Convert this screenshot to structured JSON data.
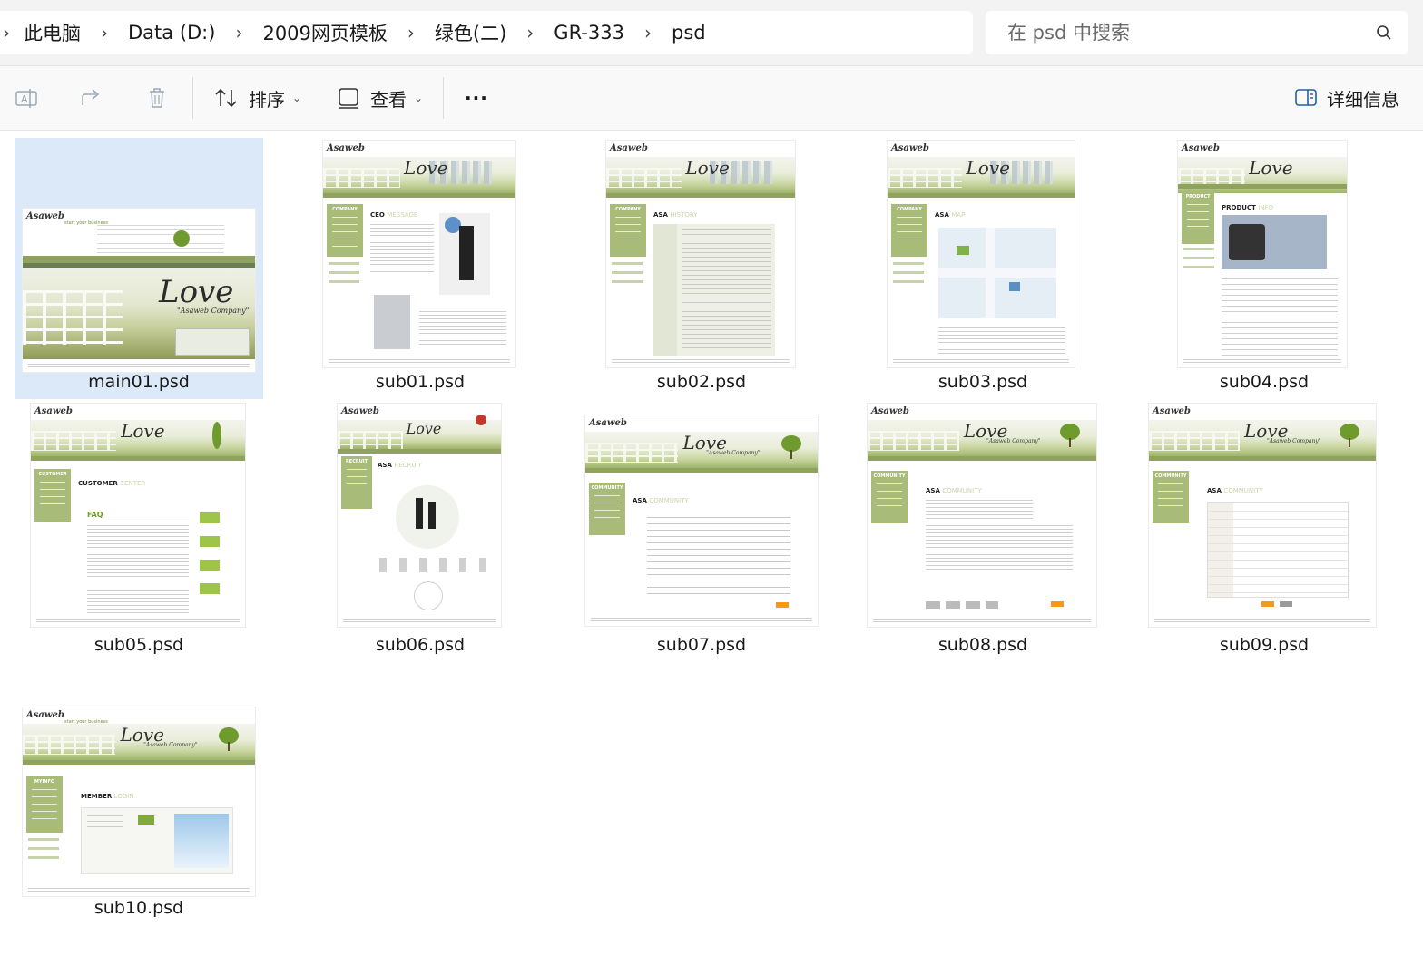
{
  "addressbar": {
    "crumbs": [
      "此电脑",
      "Data (D:)",
      "2009网页模板",
      "绿色(二)",
      "GR-333",
      "psd"
    ],
    "search_placeholder": "在 psd 中搜索"
  },
  "toolbar": {
    "rename_icon": "rename-icon",
    "share_icon": "share-icon",
    "delete_icon": "delete-icon",
    "sort_label": "排序",
    "view_label": "查看",
    "more_label": "···",
    "details_label": "详细信息"
  },
  "files": [
    {
      "name": "main01.psd",
      "selected": true
    },
    {
      "name": "sub01.psd"
    },
    {
      "name": "sub02.psd"
    },
    {
      "name": "sub03.psd"
    },
    {
      "name": "sub04.psd"
    },
    {
      "name": "sub05.psd"
    },
    {
      "name": "sub06.psd"
    },
    {
      "name": "sub07.psd"
    },
    {
      "name": "sub08.psd"
    },
    {
      "name": "sub09.psd"
    },
    {
      "name": "sub10.psd"
    }
  ],
  "thumb_text": {
    "logo": "Asaweb",
    "tagline": "start your business",
    "love": "Love",
    "company": "\"Asaweb Company\"",
    "side_company": "COMPANY",
    "side_product": "PRODUCT",
    "side_customer": "CUSTOMER",
    "side_recruit": "RECRUIT",
    "side_community": "COMMUNITY",
    "side_myinfo": "MYINFO",
    "head_ceo": "CEO",
    "head_ceo_light": "MESSAGE",
    "head_asa": "ASA",
    "head_history": "HISTORY",
    "head_map": "MAP",
    "head_product": "PRODUCT",
    "head_product_light": "INFO",
    "head_customer": "CUSTOMER",
    "head_customer_light": "CENTER",
    "head_recruit": "RECRUIT",
    "head_community": "COMMUNITY",
    "head_member": "MEMBER",
    "head_member_light": "LOGIN",
    "faq": "FAQ"
  },
  "colors": {
    "selection": "#dce9f8",
    "accent_green": "#a9bb78",
    "button_orange": "#f39a1c"
  }
}
